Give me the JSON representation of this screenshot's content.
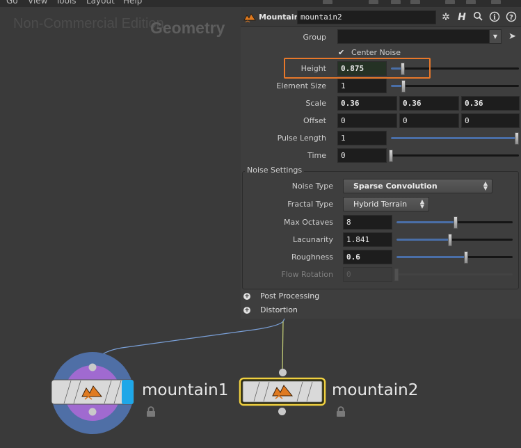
{
  "menu": {
    "items": [
      "Go",
      "View",
      "Tools",
      "Layout",
      "Help"
    ]
  },
  "network": {
    "watermark": "Non-Commercial Edition",
    "context_label": "Geometry"
  },
  "panel": {
    "node_type": "Mountain",
    "node_name": "mountain2",
    "group_label": "Group",
    "group_value": "",
    "center_noise_label": "Center Noise",
    "center_noise_checked": true,
    "height_label": "Height",
    "height_value": "0.875",
    "element_size_label": "Element Size",
    "element_size_value": "1",
    "scale_label": "Scale",
    "scale_values": [
      "0.36",
      "0.36",
      "0.36"
    ],
    "offset_label": "Offset",
    "offset_values": [
      "0",
      "0",
      "0"
    ],
    "pulse_length_label": "Pulse Length",
    "pulse_length_value": "1",
    "time_label": "Time",
    "time_value": "0",
    "noise_settings_title": "Noise Settings",
    "noise_type_label": "Noise Type",
    "noise_type_value": "Sparse Convolution",
    "fractal_type_label": "Fractal Type",
    "fractal_type_value": "Hybrid Terrain",
    "max_octaves_label": "Max Octaves",
    "max_octaves_value": "8",
    "lacunarity_label": "Lacunarity",
    "lacunarity_value": "1.841",
    "roughness_label": "Roughness",
    "roughness_value": "0.6",
    "flow_rotation_label": "Flow Rotation",
    "flow_rotation_value": "0",
    "folders": [
      "Post Processing",
      "Distortion"
    ],
    "slider_levels": {
      "height": 0.09,
      "element_size": 0.1,
      "pulse_length": 1.0,
      "time": 0.0,
      "max_octaves": 0.51,
      "lacunarity": 0.46,
      "roughness": 0.6,
      "flow_rotation": 0.0
    }
  },
  "nodes": [
    {
      "name": "mountain1",
      "selected": false,
      "display_flag": true
    },
    {
      "name": "mountain2",
      "selected": true,
      "display_flag": false
    }
  ],
  "colors": {
    "highlight": "#e8782a",
    "slider_fill": "#4a6fa8",
    "node_selected_outline": "#f0d040",
    "display_flag": "#1ea7e8",
    "node_icon": "#e07a20",
    "wire": "#7aa0d8"
  }
}
